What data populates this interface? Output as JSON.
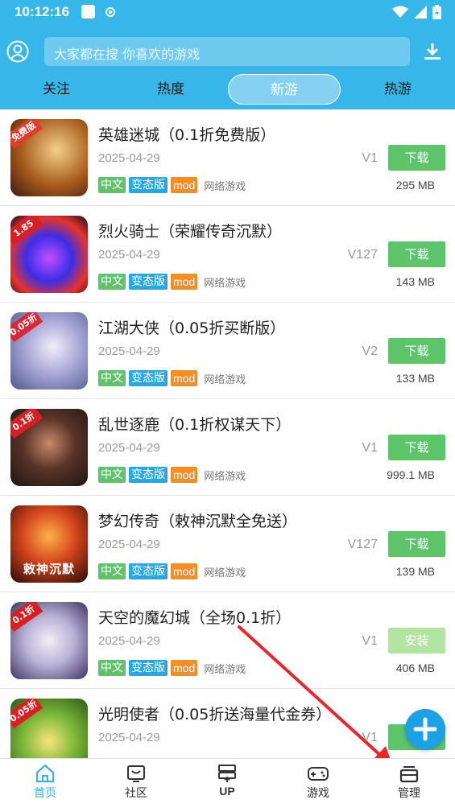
{
  "status_bar": {
    "time": "10:12:16"
  },
  "search": {
    "placeholder": "大家都在搜 你喜欢的游戏"
  },
  "tabs": [
    {
      "label": "关注",
      "active": false
    },
    {
      "label": "热度",
      "active": false
    },
    {
      "label": "新游",
      "active": true
    },
    {
      "label": "热游",
      "active": false
    }
  ],
  "games": [
    {
      "name": "英雄迷城（0.1折免费版）",
      "date": "2025-04-29",
      "version": "V1",
      "button": "下载",
      "size": "295 MB",
      "tags": [
        "中文",
        "变态版",
        "mod"
      ],
      "category": "网络游戏",
      "badge": "免费版"
    },
    {
      "name": "烈火骑士（荣耀传奇沉默）",
      "date": "2025-04-29",
      "version": "V127",
      "button": "下载",
      "size": "143 MB",
      "tags": [
        "中文",
        "变态版",
        "mod"
      ],
      "category": "网络游戏",
      "badge": "1.85"
    },
    {
      "name": "江湖大侠（0.05折买断版）",
      "date": "2025-04-29",
      "version": "V2",
      "button": "下载",
      "size": "133 MB",
      "tags": [
        "中文",
        "变态版",
        "mod"
      ],
      "category": "网络游戏",
      "badge": "0.05折"
    },
    {
      "name": "乱世逐鹿（0.1折权谋天下）",
      "date": "2025-04-29",
      "version": "V1",
      "button": "下载",
      "size": "999.1 MB",
      "tags": [
        "中文",
        "变态版",
        "mod"
      ],
      "category": "网络游戏",
      "badge": "0.1折"
    },
    {
      "name": "梦幻传奇（敕神沉默全免送）",
      "date": "2025-04-29",
      "version": "V127",
      "button": "下载",
      "size": "139 MB",
      "tags": [
        "中文",
        "变态版",
        "mod"
      ],
      "category": "网络游戏",
      "badge": "敕神沉默"
    },
    {
      "name": "天空的魔幻城（全场0.1折）",
      "date": "2025-04-29",
      "version": "V1",
      "button": "安装",
      "size": "406 MB",
      "tags": [
        "中文",
        "变态版",
        "mod"
      ],
      "category": "网络游戏",
      "badge": "0.1折"
    },
    {
      "name": "光明使者（0.05折送海量代金券）",
      "date": "2025-04-29",
      "version": "V1",
      "button": "下载",
      "size": "",
      "tags": [],
      "category": "",
      "badge": "0.05折"
    }
  ],
  "bottom_nav": [
    {
      "label": "首页",
      "icon": "home-icon",
      "active": true
    },
    {
      "label": "社区",
      "icon": "community-icon",
      "active": false
    },
    {
      "label": "UP",
      "icon": "up-icon",
      "active": false
    },
    {
      "label": "游戏",
      "icon": "gamepad-icon",
      "active": false
    },
    {
      "label": "管理",
      "icon": "manage-icon",
      "active": false
    }
  ],
  "colors": {
    "header": "#37b6e9",
    "download_button": "#5ec469",
    "install_button": "#b4e5a0",
    "tag_green": "#62c26c",
    "tag_blue": "#27a8e6",
    "tag_orange": "#f28e25",
    "fab": "#1da1e6",
    "arrow": "#e8262b"
  }
}
